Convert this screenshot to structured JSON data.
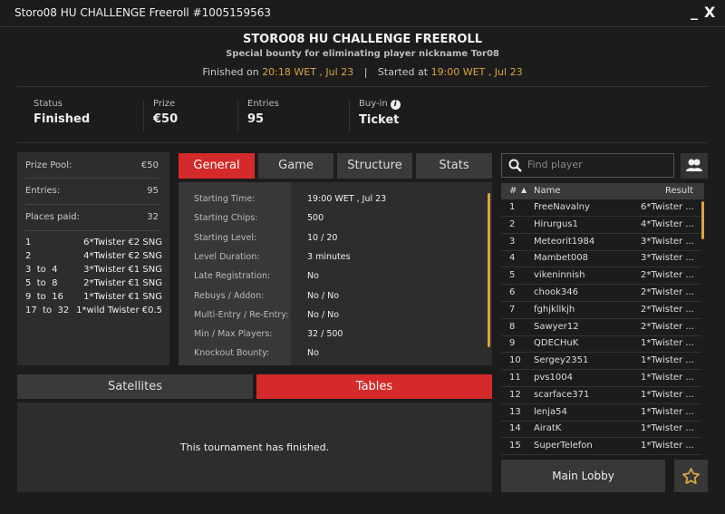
{
  "window": {
    "title": "Storo08 HU CHALLENGE Freeroll #1005159563",
    "minimize": "_",
    "close": "X"
  },
  "header": {
    "title": "STORO08 HU CHALLENGE FREEROLL",
    "subtitle": "Special bounty for eliminating player nickname Tor08",
    "finished_label": "Finished on",
    "finished_time": "20:18 WET , Jul 23",
    "separator": "|",
    "started_label": "Started at",
    "started_time": "19:00 WET , Jul 23"
  },
  "stats": {
    "status_label": "Status",
    "status": "Finished",
    "prize_label": "Prize",
    "prize": "€50",
    "entries_label": "Entries",
    "entries": "95",
    "buyin_label": "Buy-in",
    "buyin": "Ticket"
  },
  "summary": {
    "prize_pool_label": "Prize Pool:",
    "prize_pool": "€50",
    "entries_label": "Entries:",
    "entries": "95",
    "places_label": "Places paid:",
    "places": "32",
    "payouts": [
      {
        "place": "1",
        "prize": "6*Twister €2 SNG"
      },
      {
        "place": "2",
        "prize": "4*Twister €2 SNG"
      },
      {
        "place": "3  to  4",
        "prize": "3*Twister €1 SNG"
      },
      {
        "place": "5  to  8",
        "prize": "2*Twister €1 SNG"
      },
      {
        "place": "9  to  16",
        "prize": "1*Twister €1 SNG"
      },
      {
        "place": "17  to  32",
        "prize": "1*wild Twister €0.5"
      }
    ]
  },
  "tabs": [
    {
      "label": "General",
      "active": true
    },
    {
      "label": "Game"
    },
    {
      "label": "Structure"
    },
    {
      "label": "Stats"
    }
  ],
  "general": [
    {
      "label": "Starting Time:",
      "value": "19:00 WET , Jul 23"
    },
    {
      "label": "Starting Chips:",
      "value": "500"
    },
    {
      "label": "Starting Level:",
      "value": "10 / 20"
    },
    {
      "label": "Level Duration:",
      "value": "3 minutes"
    },
    {
      "label": "Late Registration:",
      "value": "No"
    },
    {
      "label": "Rebuys / Addon:",
      "value": "No / No"
    },
    {
      "label": "Multi-Entry / Re-Entry:",
      "value": "No / No"
    },
    {
      "label": "Min / Max Players:",
      "value": "32 / 500"
    },
    {
      "label": "Knockout Bounty:",
      "value": "No"
    }
  ],
  "bottom_tabs": {
    "satellites": "Satellites",
    "tables": "Tables",
    "active": "Tables",
    "message": "This tournament has finished."
  },
  "players": {
    "search_placeholder": "Find player",
    "col_rank": "#",
    "sort_icon": "▲",
    "col_name": "Name",
    "col_result": "Result",
    "rows": [
      [
        "1",
        "FreeNavalny",
        "6*Twister ..."
      ],
      [
        "2",
        "Hirurgus1",
        "4*Twister ..."
      ],
      [
        "3",
        "Meteorit1984",
        "3*Twister ..."
      ],
      [
        "4",
        "Mambet008",
        "3*Twister ..."
      ],
      [
        "5",
        "vikeninnish",
        "2*Twister ..."
      ],
      [
        "6",
        "chook346",
        "2*Twister ..."
      ],
      [
        "7",
        "fghjkllkjh",
        "2*Twister ..."
      ],
      [
        "8",
        "Sawyer12",
        "2*Twister ..."
      ],
      [
        "9",
        "QDECHuK",
        "1*Twister ..."
      ],
      [
        "10",
        "Sergey2351",
        "1*Twister ..."
      ],
      [
        "11",
        "pvs1004",
        "1*Twister ..."
      ],
      [
        "12",
        "scarface371",
        "1*Twister ..."
      ],
      [
        "13",
        "lenja54",
        "1*Twister ..."
      ],
      [
        "14",
        "AiratK",
        "1*Twister ..."
      ],
      [
        "15",
        "SuperTelefon",
        "1*Twister ..."
      ]
    ]
  },
  "footer": {
    "main_lobby": "Main Lobby"
  },
  "colors": {
    "accent": "#d42a2a",
    "highlight": "#d9a441"
  }
}
